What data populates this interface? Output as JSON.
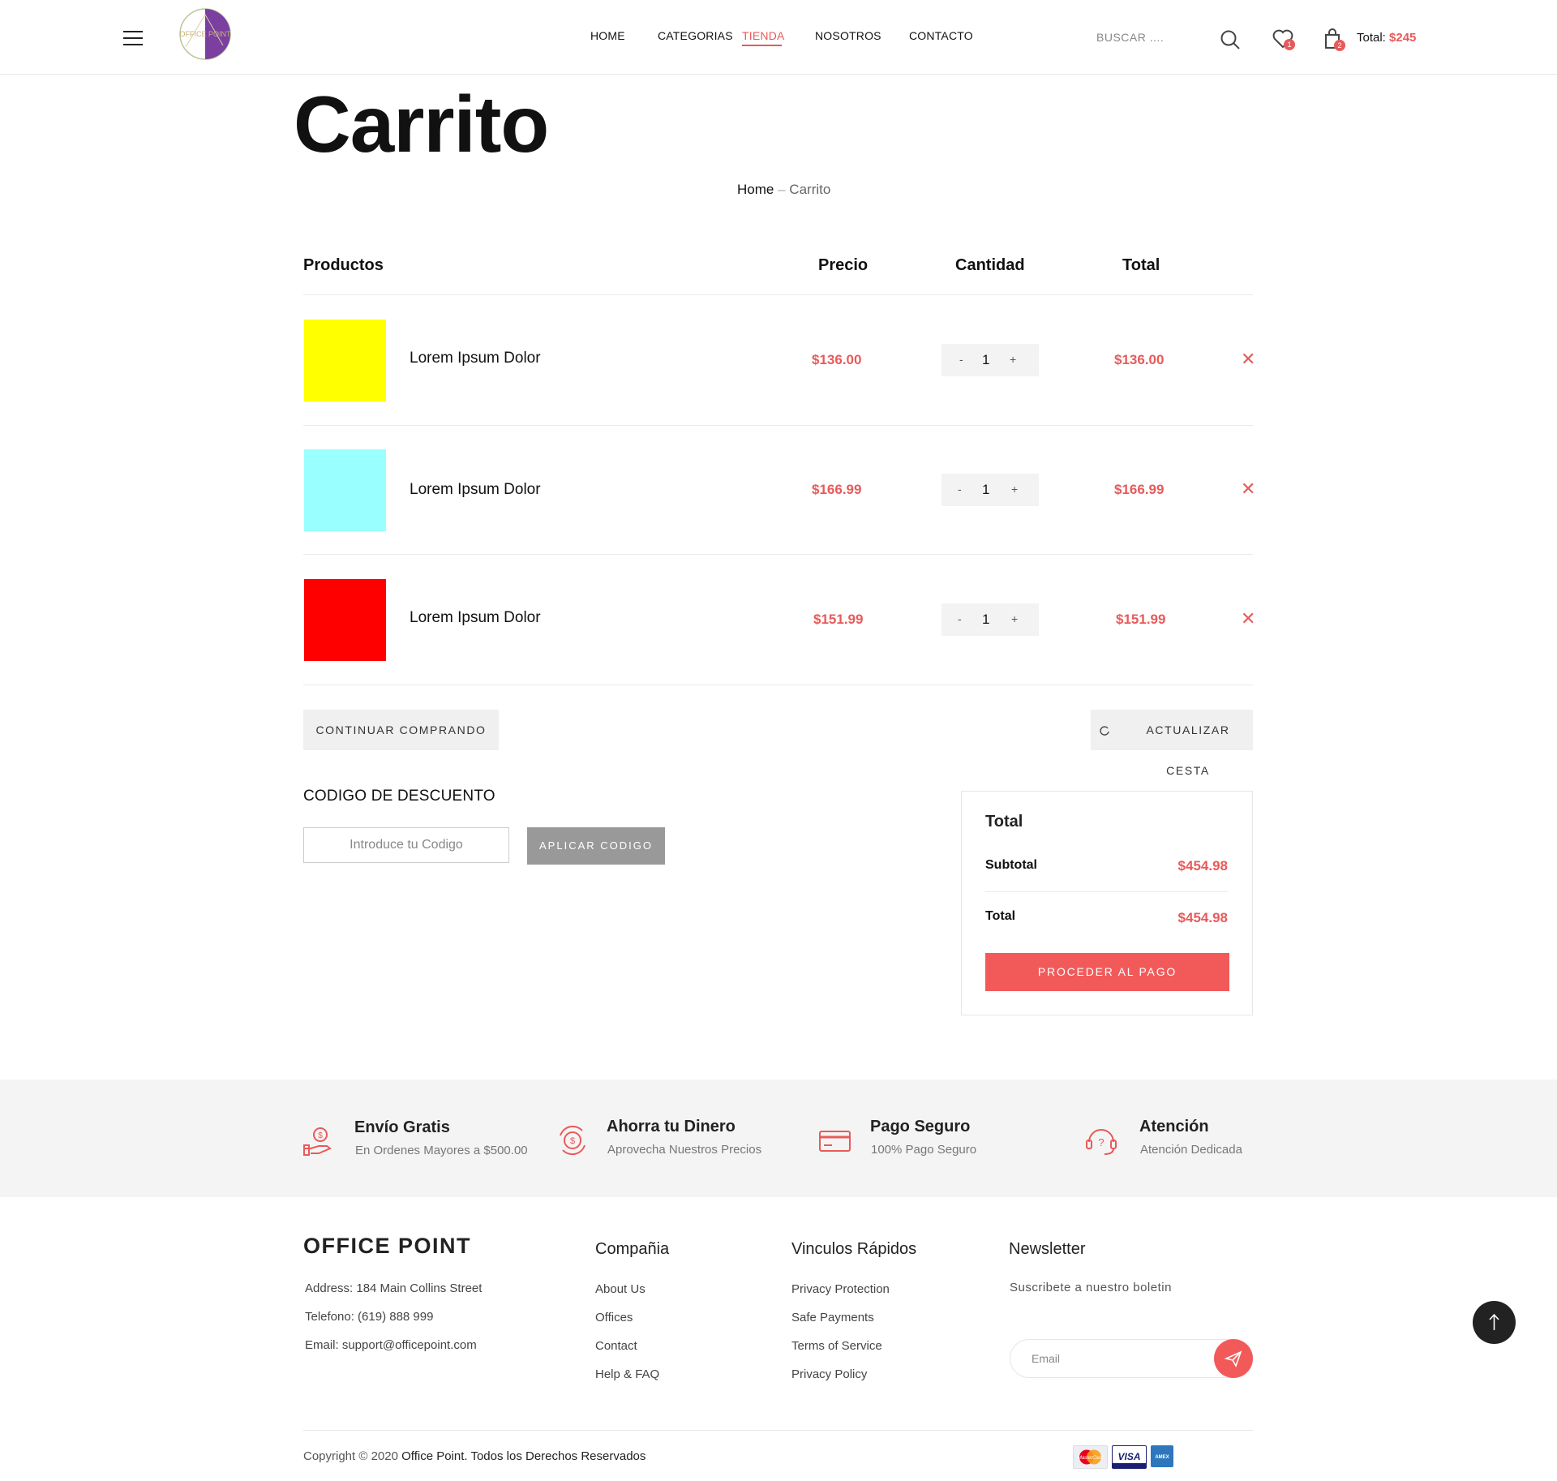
{
  "header": {
    "nav": [
      "HOME",
      "CATEGORIAS",
      "TIENDA",
      "NOSOTROS",
      "CONTACTO"
    ],
    "logo_text": "OFFICE POINT",
    "search_label": "BUSCAR ....",
    "wishlist_count": "1",
    "cart_count": "2",
    "total_label": "Total:",
    "total_amount": "$245"
  },
  "page": {
    "title": "Carrito",
    "breadcrumb_home": "Home",
    "breadcrumb_sep": "–",
    "breadcrumb_current": "Carrito"
  },
  "cart": {
    "headers": {
      "product": "Productos",
      "price": "Precio",
      "quantity": "Cantidad",
      "total": "Total"
    },
    "items": [
      {
        "name": "Lorem Ipsum Dolor",
        "color": "#ffff00",
        "price": "$136.00",
        "qty": "1",
        "total": "$136.00"
      },
      {
        "name": "Lorem Ipsum Dolor",
        "color": "#99ffff",
        "price": "$166.99",
        "qty": "1",
        "total": "$166.99"
      },
      {
        "name": "Lorem Ipsum Dolor",
        "color": "#ff0000",
        "price": "$151.99",
        "qty": "1",
        "total": "$151.99"
      }
    ],
    "minus": "-",
    "plus": "+",
    "remove": "✕",
    "continue_button": "CONTINUAR COMPRANDO",
    "update_button": "ACTUALIZAR CESTA"
  },
  "discount": {
    "title": "CODIGO DE DESCUENTO",
    "placeholder": "Introduce tu Codigo",
    "button": "APLICAR CODIGO"
  },
  "totals": {
    "title": "Total",
    "subtotal_label": "Subtotal",
    "subtotal_value": "$454.98",
    "total_label": "Total",
    "total_value": "$454.98",
    "checkout_button": "PROCEDER AL PAGO"
  },
  "features": [
    {
      "title": "Envío Gratis",
      "subtitle": "En Ordenes Mayores a $500.00",
      "icon": "hand-money-icon"
    },
    {
      "title": "Ahorra tu Dinero",
      "subtitle": "Aprovecha Nuestros Precios",
      "icon": "money-cycle-icon"
    },
    {
      "title": "Pago Seguro",
      "subtitle": "100% Pago Seguro",
      "icon": "credit-card-icon"
    },
    {
      "title": "Atención",
      "subtitle": "Atención Dedicada",
      "icon": "support-headset-icon"
    }
  ],
  "footer": {
    "brand": "OFFICE POINT",
    "address": "Address: 184 Main Collins Street",
    "phone": "Telefono: (619) 888 999",
    "email": "Email: support@officepoint.com",
    "company_title": "Compañia",
    "company_links": [
      "About Us",
      "Offices",
      "Contact",
      "Help & FAQ"
    ],
    "quick_title": "Vinculos Rápidos",
    "quick_links": [
      "Privacy Protection",
      "Safe Payments",
      "Terms of Service",
      "Privacy Policy"
    ],
    "newsletter_title": "Newsletter",
    "newsletter_sub": "Suscribete a nuestro boletin",
    "email_placeholder": "Email",
    "copyright_prefix": "Copyright © 2020",
    "copyright_strong": "Office Point. Todos los Derechos Reservados",
    "payments": [
      "MasterCard",
      "VISA",
      "AMEX"
    ]
  },
  "colors": {
    "accent": "#e85a5a",
    "button_red": "#f25a5a",
    "logo_purple": "#7b3fa0"
  }
}
